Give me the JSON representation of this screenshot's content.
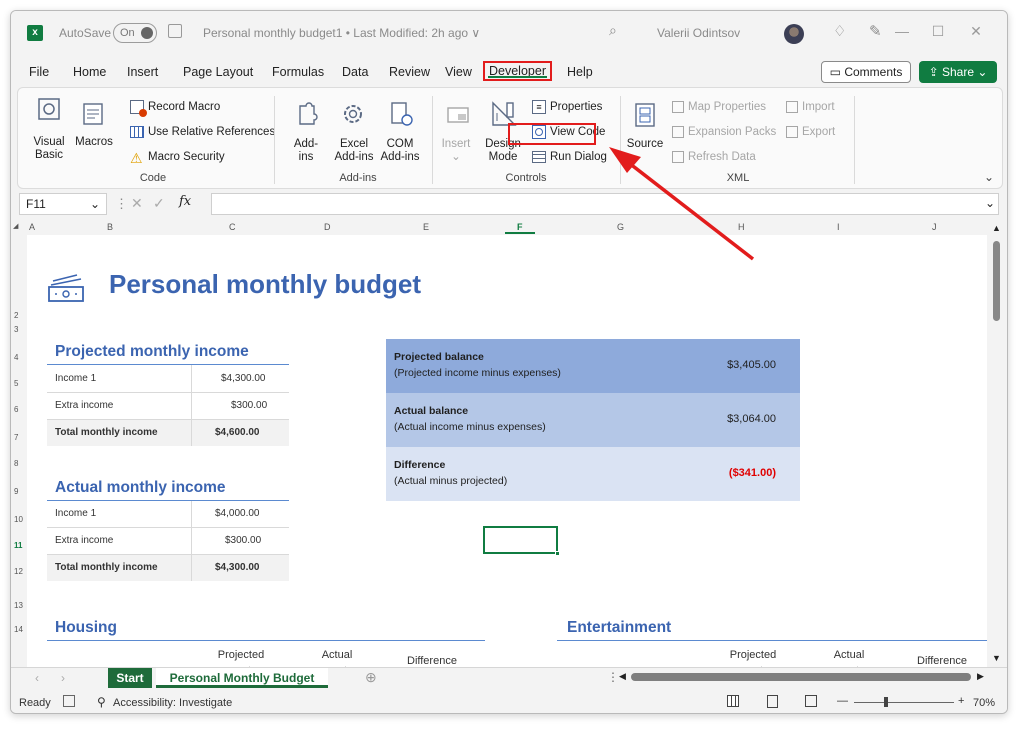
{
  "titlebar": {
    "autosave_label": "AutoSave",
    "autosave_state": "On",
    "doc_title": "Personal monthly budget1 • Last Modified: 2h ago ∨",
    "user_name": "Valerii Odintsov"
  },
  "menu": [
    "File",
    "Home",
    "Insert",
    "Page Layout",
    "Formulas",
    "Data",
    "Review",
    "View",
    "Developer",
    "Help"
  ],
  "buttons": {
    "comments": "Comments",
    "share": "Share"
  },
  "ribbon": {
    "code": {
      "visual_basic": "Visual\nBasic",
      "macros": "Macros",
      "record_macro": "Record Macro",
      "use_relative": "Use Relative References",
      "macro_security": "Macro Security",
      "group": "Code"
    },
    "addins": {
      "addins": "Add-\nins",
      "excel_addins": "Excel\nAdd-ins",
      "com_addins": "COM\nAdd-ins",
      "group": "Add-ins"
    },
    "controls": {
      "insert": "Insert",
      "design_mode": "Design\nMode",
      "properties": "Properties",
      "view_code": "View Code",
      "run_dialog": "Run Dialog",
      "group": "Controls"
    },
    "xml": {
      "source": "Source",
      "map_properties": "Map Properties",
      "expansion_packs": "Expansion Packs",
      "refresh_data": "Refresh Data",
      "import": "Import",
      "export": "Export",
      "group": "XML"
    }
  },
  "formula_bar": {
    "name_box": "F11",
    "fx": "fx",
    "value": ""
  },
  "columns": [
    "A",
    "B",
    "C",
    "D",
    "E",
    "F",
    "G",
    "H",
    "I",
    "J"
  ],
  "rows": [
    "2",
    "3",
    "4",
    "5",
    "6",
    "7",
    "8",
    "9",
    "10",
    "11",
    "12",
    "13",
    "14"
  ],
  "sheet": {
    "title": "Personal monthly budget",
    "projected_income": {
      "title": "Projected monthly income",
      "rows": [
        {
          "label": "Income 1",
          "value": "$4,300.00"
        },
        {
          "label": "Extra income",
          "value": "$300.00"
        },
        {
          "label": "Total monthly income",
          "value": "$4,600.00"
        }
      ]
    },
    "actual_income": {
      "title": "Actual monthly income",
      "rows": [
        {
          "label": "Income 1",
          "value": "$4,000.00"
        },
        {
          "label": "Extra income",
          "value": "$300.00"
        },
        {
          "label": "Total monthly income",
          "value": "$4,300.00"
        }
      ]
    },
    "balance": [
      {
        "title": "Projected balance",
        "sub": "(Projected income minus expenses)",
        "value": "$3,405.00",
        "bg": "#8eaadb"
      },
      {
        "title": "Actual balance",
        "sub": "(Actual income minus expenses)",
        "value": "$3,064.00",
        "bg": "#b4c7e7"
      },
      {
        "title": "Difference",
        "sub": "(Actual minus projected)",
        "value": "($341.00)",
        "bg": "#dae3f3",
        "value_color": "#e00000"
      }
    ],
    "housing": {
      "title": "Housing",
      "headers": [
        "Projected\ncost",
        "Actual\ncost",
        "Difference"
      ]
    },
    "entertainment": {
      "title": "Entertainment",
      "headers": [
        "Projected\ncost",
        "Actual\ncost",
        "Difference"
      ]
    }
  },
  "tabs": [
    "Start",
    "Personal Monthly Budget"
  ],
  "status": {
    "ready": "Ready",
    "accessibility": "Accessibility: Investigate",
    "zoom": "70%"
  },
  "colors": {
    "accent_green": "#107c41",
    "title_blue": "#3b64b0",
    "highlight_red": "#e21c1c"
  }
}
